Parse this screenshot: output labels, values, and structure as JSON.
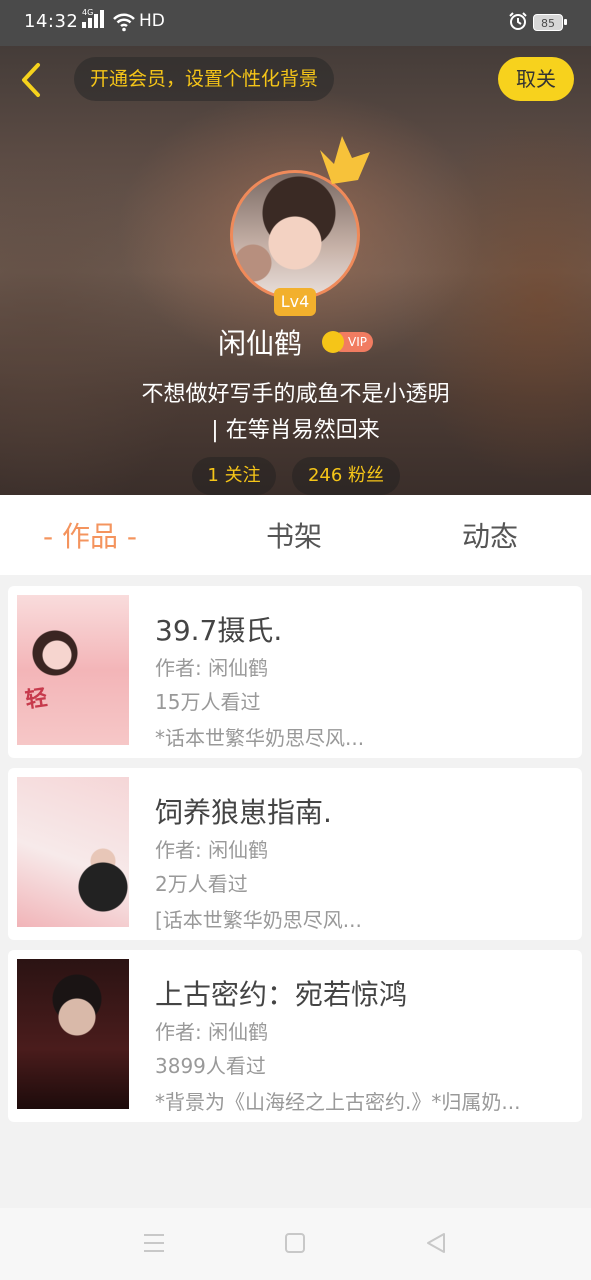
{
  "status_bar": {
    "time": "14:32",
    "network": "4G",
    "hd": "HD",
    "battery": "85"
  },
  "header": {
    "vip_banner": "开通会员，设置个性化背景",
    "cancel_follow": "取关"
  },
  "profile": {
    "level": "Lv4",
    "username": "闲仙鹤",
    "vip_label": "VIP",
    "bio_line1": "不想做好写手的咸鱼不是小透明",
    "bio_line2": "| 在等肖易然回来",
    "following": "1 关注",
    "followers": "246 粉丝"
  },
  "tabs": [
    {
      "label": "- 作品 -",
      "active": true
    },
    {
      "label": "书架",
      "active": false
    },
    {
      "label": "动态",
      "active": false
    }
  ],
  "books": [
    {
      "title": "39.7摄氏.",
      "author": "作者: 闲仙鹤",
      "views": "15万人看过",
      "desc": "*话本世繁华奶思尽风..."
    },
    {
      "title": "饲养狼崽指南.",
      "author": "作者: 闲仙鹤",
      "views": "2万人看过",
      "desc": "[话本世繁华奶思尽风..."
    },
    {
      "title": "上古密约：宛若惊鸿",
      "author": "作者: 闲仙鹤",
      "views": "3899人看过",
      "desc": "*背景为《山海经之上古密约.》*归属奶..."
    }
  ],
  "colors": {
    "accent_yellow": "#f7d21d",
    "tab_active": "#f4945e",
    "level_badge": "#f2b02d"
  }
}
